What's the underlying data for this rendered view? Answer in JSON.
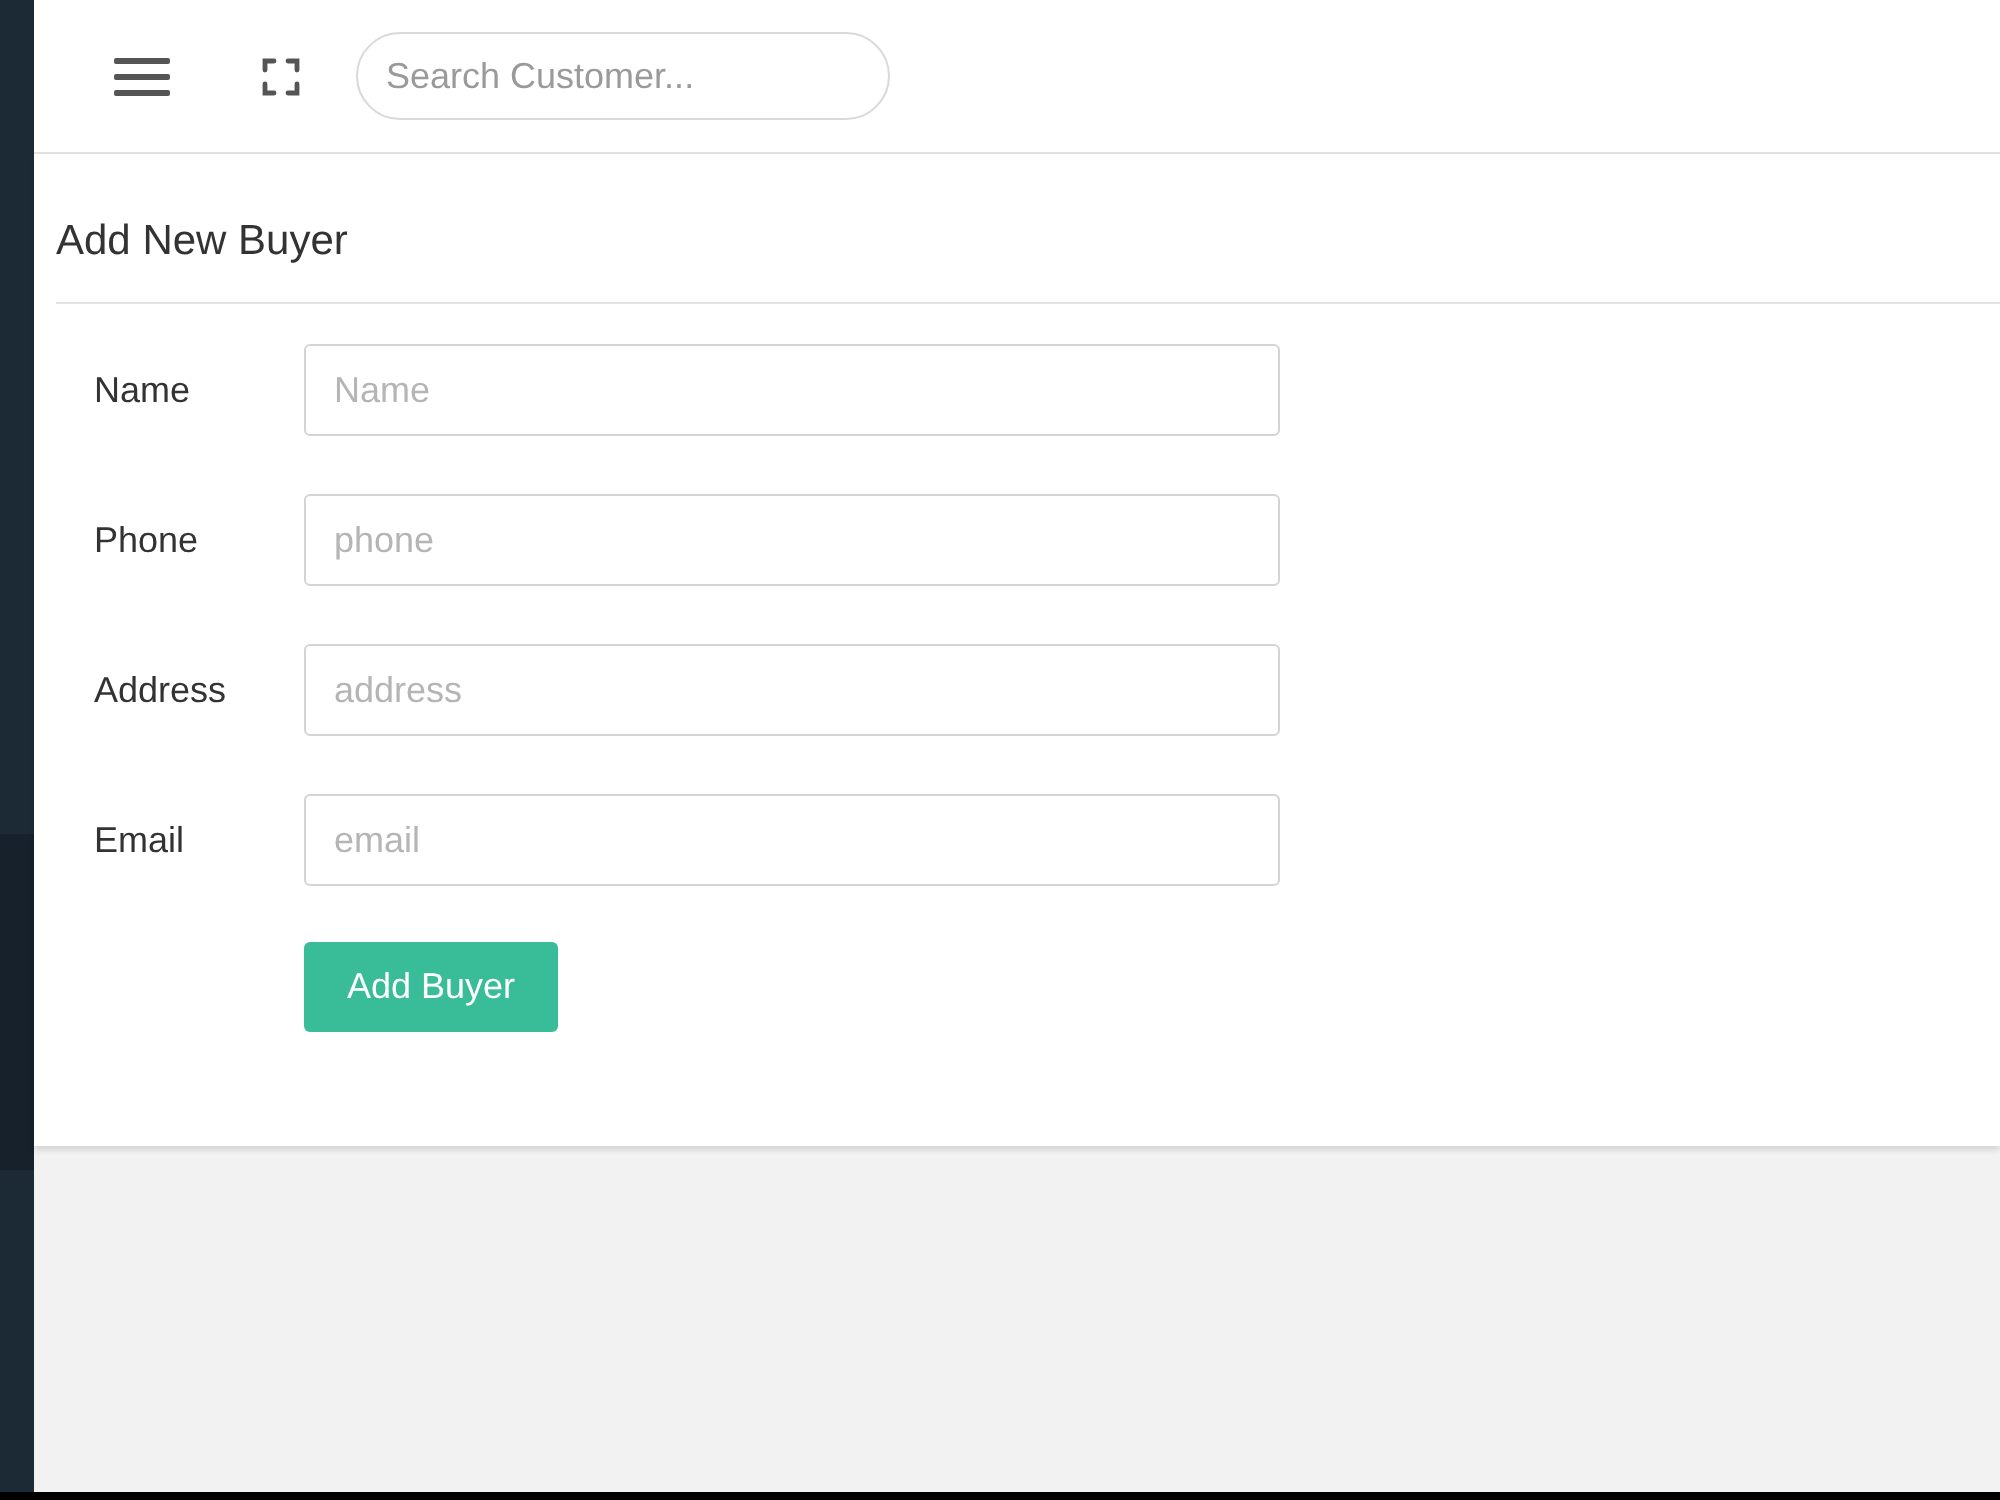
{
  "header": {
    "search": {
      "placeholder": "Search Customer..."
    }
  },
  "card": {
    "title": "Add New Buyer",
    "fields": [
      {
        "label": "Name",
        "placeholder": "Name"
      },
      {
        "label": "Phone",
        "placeholder": "phone"
      },
      {
        "label": "Address",
        "placeholder": "address"
      },
      {
        "label": "Email",
        "placeholder": "email"
      }
    ],
    "submit_button": "Add Buyer"
  }
}
